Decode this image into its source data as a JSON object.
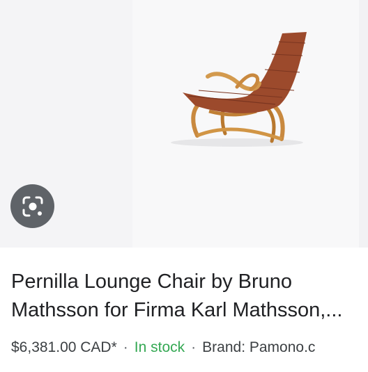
{
  "product": {
    "title_line1": "Pernilla Lounge Chair by Bruno",
    "title_line2": "Mathsson for Firma Karl Mathsson,...",
    "price": "$6,381.00 CAD*",
    "separator": "·",
    "availability": "In stock",
    "brand": "Brand: Pamono.c"
  },
  "colors": {
    "availability": "#34a853",
    "lens_button": "#5f6368"
  },
  "icons": {
    "lens": "google-lens-icon"
  }
}
